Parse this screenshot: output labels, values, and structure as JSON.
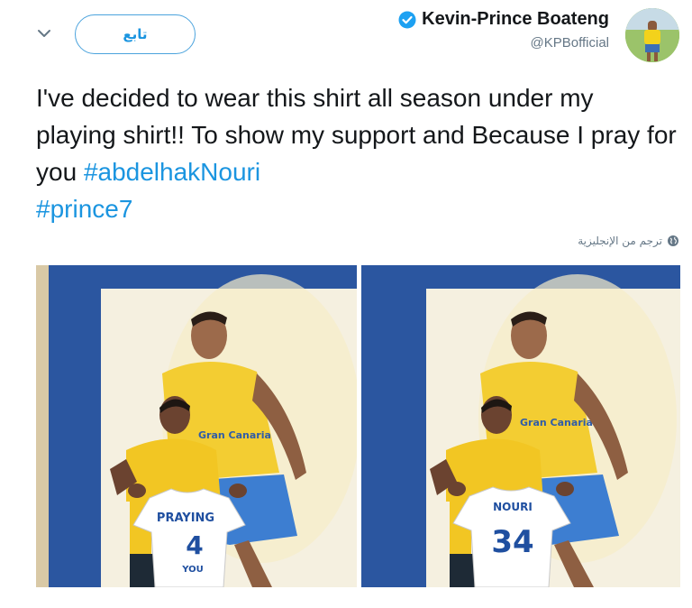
{
  "header": {
    "display_name": "Kevin-Prince Boateng",
    "handle": "@KPBofficial",
    "follow_label": "تابع"
  },
  "tweet": {
    "text_plain": "I've decided to wear this shirt all season under my playing shirt!! To show my support and Because I pray for you ",
    "hashtag_1": "#abdelhakNouri",
    "hashtag_2": "#prince7",
    "translate_label": "ترجم من الإنجليزية"
  },
  "photos": {
    "left": {
      "jersey_top": "PRAYING",
      "jersey_number": "4",
      "jersey_bottom": "YOU",
      "mural_text": "Gran Canaria"
    },
    "right": {
      "jersey_top": "NOURI",
      "jersey_number": "34",
      "mural_text": "Gran Canaria"
    }
  },
  "icons": {
    "chevron": "chevron-down-icon",
    "verified": "verified-badge-icon",
    "globe": "globe-icon"
  },
  "colors": {
    "link": "#1b95e0",
    "secondary_text": "#657786",
    "verified": "#1da1f2"
  }
}
